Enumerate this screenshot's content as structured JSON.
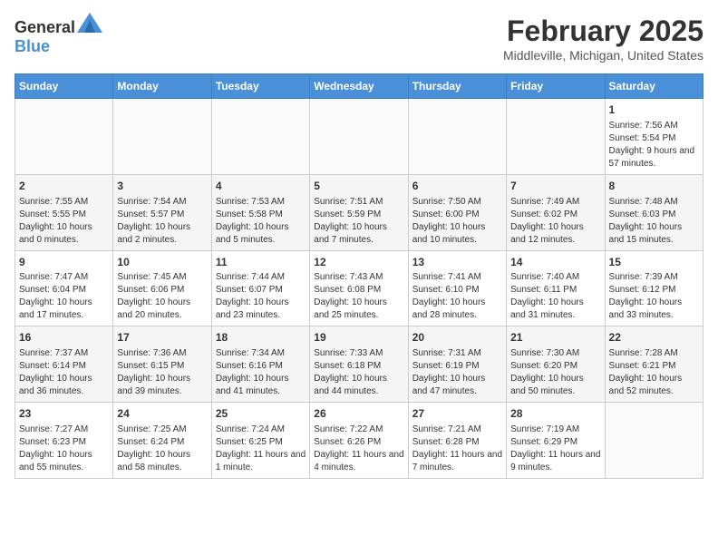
{
  "header": {
    "logo_general": "General",
    "logo_blue": "Blue",
    "title": "February 2025",
    "location": "Middleville, Michigan, United States"
  },
  "days_of_week": [
    "Sunday",
    "Monday",
    "Tuesday",
    "Wednesday",
    "Thursday",
    "Friday",
    "Saturday"
  ],
  "weeks": [
    [
      {
        "day": "",
        "info": ""
      },
      {
        "day": "",
        "info": ""
      },
      {
        "day": "",
        "info": ""
      },
      {
        "day": "",
        "info": ""
      },
      {
        "day": "",
        "info": ""
      },
      {
        "day": "",
        "info": ""
      },
      {
        "day": "1",
        "info": "Sunrise: 7:56 AM\nSunset: 5:54 PM\nDaylight: 9 hours and 57 minutes."
      }
    ],
    [
      {
        "day": "2",
        "info": "Sunrise: 7:55 AM\nSunset: 5:55 PM\nDaylight: 10 hours and 0 minutes."
      },
      {
        "day": "3",
        "info": "Sunrise: 7:54 AM\nSunset: 5:57 PM\nDaylight: 10 hours and 2 minutes."
      },
      {
        "day": "4",
        "info": "Sunrise: 7:53 AM\nSunset: 5:58 PM\nDaylight: 10 hours and 5 minutes."
      },
      {
        "day": "5",
        "info": "Sunrise: 7:51 AM\nSunset: 5:59 PM\nDaylight: 10 hours and 7 minutes."
      },
      {
        "day": "6",
        "info": "Sunrise: 7:50 AM\nSunset: 6:00 PM\nDaylight: 10 hours and 10 minutes."
      },
      {
        "day": "7",
        "info": "Sunrise: 7:49 AM\nSunset: 6:02 PM\nDaylight: 10 hours and 12 minutes."
      },
      {
        "day": "8",
        "info": "Sunrise: 7:48 AM\nSunset: 6:03 PM\nDaylight: 10 hours and 15 minutes."
      }
    ],
    [
      {
        "day": "9",
        "info": "Sunrise: 7:47 AM\nSunset: 6:04 PM\nDaylight: 10 hours and 17 minutes."
      },
      {
        "day": "10",
        "info": "Sunrise: 7:45 AM\nSunset: 6:06 PM\nDaylight: 10 hours and 20 minutes."
      },
      {
        "day": "11",
        "info": "Sunrise: 7:44 AM\nSunset: 6:07 PM\nDaylight: 10 hours and 23 minutes."
      },
      {
        "day": "12",
        "info": "Sunrise: 7:43 AM\nSunset: 6:08 PM\nDaylight: 10 hours and 25 minutes."
      },
      {
        "day": "13",
        "info": "Sunrise: 7:41 AM\nSunset: 6:10 PM\nDaylight: 10 hours and 28 minutes."
      },
      {
        "day": "14",
        "info": "Sunrise: 7:40 AM\nSunset: 6:11 PM\nDaylight: 10 hours and 31 minutes."
      },
      {
        "day": "15",
        "info": "Sunrise: 7:39 AM\nSunset: 6:12 PM\nDaylight: 10 hours and 33 minutes."
      }
    ],
    [
      {
        "day": "16",
        "info": "Sunrise: 7:37 AM\nSunset: 6:14 PM\nDaylight: 10 hours and 36 minutes."
      },
      {
        "day": "17",
        "info": "Sunrise: 7:36 AM\nSunset: 6:15 PM\nDaylight: 10 hours and 39 minutes."
      },
      {
        "day": "18",
        "info": "Sunrise: 7:34 AM\nSunset: 6:16 PM\nDaylight: 10 hours and 41 minutes."
      },
      {
        "day": "19",
        "info": "Sunrise: 7:33 AM\nSunset: 6:18 PM\nDaylight: 10 hours and 44 minutes."
      },
      {
        "day": "20",
        "info": "Sunrise: 7:31 AM\nSunset: 6:19 PM\nDaylight: 10 hours and 47 minutes."
      },
      {
        "day": "21",
        "info": "Sunrise: 7:30 AM\nSunset: 6:20 PM\nDaylight: 10 hours and 50 minutes."
      },
      {
        "day": "22",
        "info": "Sunrise: 7:28 AM\nSunset: 6:21 PM\nDaylight: 10 hours and 52 minutes."
      }
    ],
    [
      {
        "day": "23",
        "info": "Sunrise: 7:27 AM\nSunset: 6:23 PM\nDaylight: 10 hours and 55 minutes."
      },
      {
        "day": "24",
        "info": "Sunrise: 7:25 AM\nSunset: 6:24 PM\nDaylight: 10 hours and 58 minutes."
      },
      {
        "day": "25",
        "info": "Sunrise: 7:24 AM\nSunset: 6:25 PM\nDaylight: 11 hours and 1 minute."
      },
      {
        "day": "26",
        "info": "Sunrise: 7:22 AM\nSunset: 6:26 PM\nDaylight: 11 hours and 4 minutes."
      },
      {
        "day": "27",
        "info": "Sunrise: 7:21 AM\nSunset: 6:28 PM\nDaylight: 11 hours and 7 minutes."
      },
      {
        "day": "28",
        "info": "Sunrise: 7:19 AM\nSunset: 6:29 PM\nDaylight: 11 hours and 9 minutes."
      },
      {
        "day": "",
        "info": ""
      }
    ]
  ]
}
